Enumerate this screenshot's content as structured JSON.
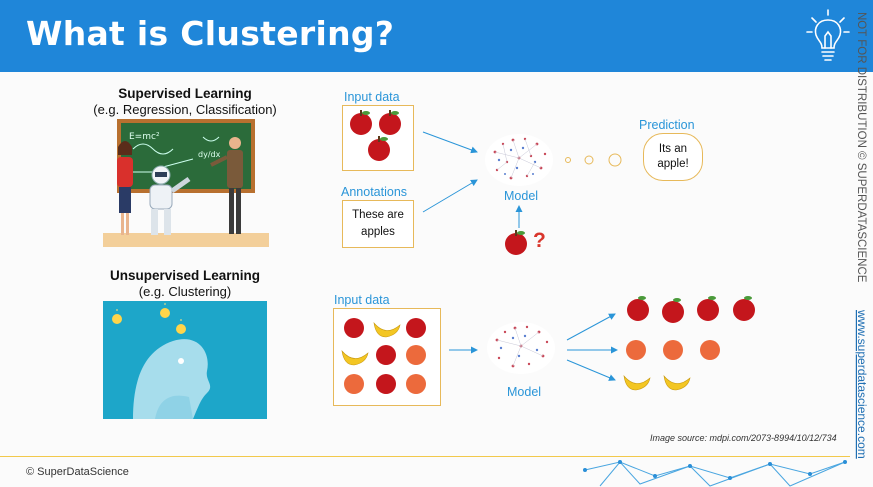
{
  "header": {
    "title": "What is Clustering?"
  },
  "side": {
    "notice": "NOT FOR DISTRIBUTION © SUPERDATASCIENCE",
    "url": "www.superdatascience.com"
  },
  "supervised": {
    "title": "Supervised Learning",
    "subtitle": "(e.g. Regression, Classification)",
    "input_label": "Input data",
    "annotations_label": "Annotations",
    "annotation_line1": "These are",
    "annotation_line2": "apples",
    "model_label": "Model",
    "prediction_label": "Prediction",
    "prediction_line1": "Its an",
    "prediction_line2": "apple!",
    "question_mark": "?",
    "board_formula1": "E=mc²",
    "board_formula2": "dy/dx"
  },
  "unsupervised": {
    "title": "Unsupervised Learning",
    "subtitle": "(e.g. Clustering)",
    "input_label": "Input data",
    "model_label": "Model"
  },
  "footer": {
    "copyright": "© SuperDataScience",
    "source": "Image source: mdpi.com/2073-8994/10/12/734"
  },
  "colors": {
    "header": "#1f86d9",
    "accent": "#2a95d8",
    "box_border": "#e7b95a"
  }
}
